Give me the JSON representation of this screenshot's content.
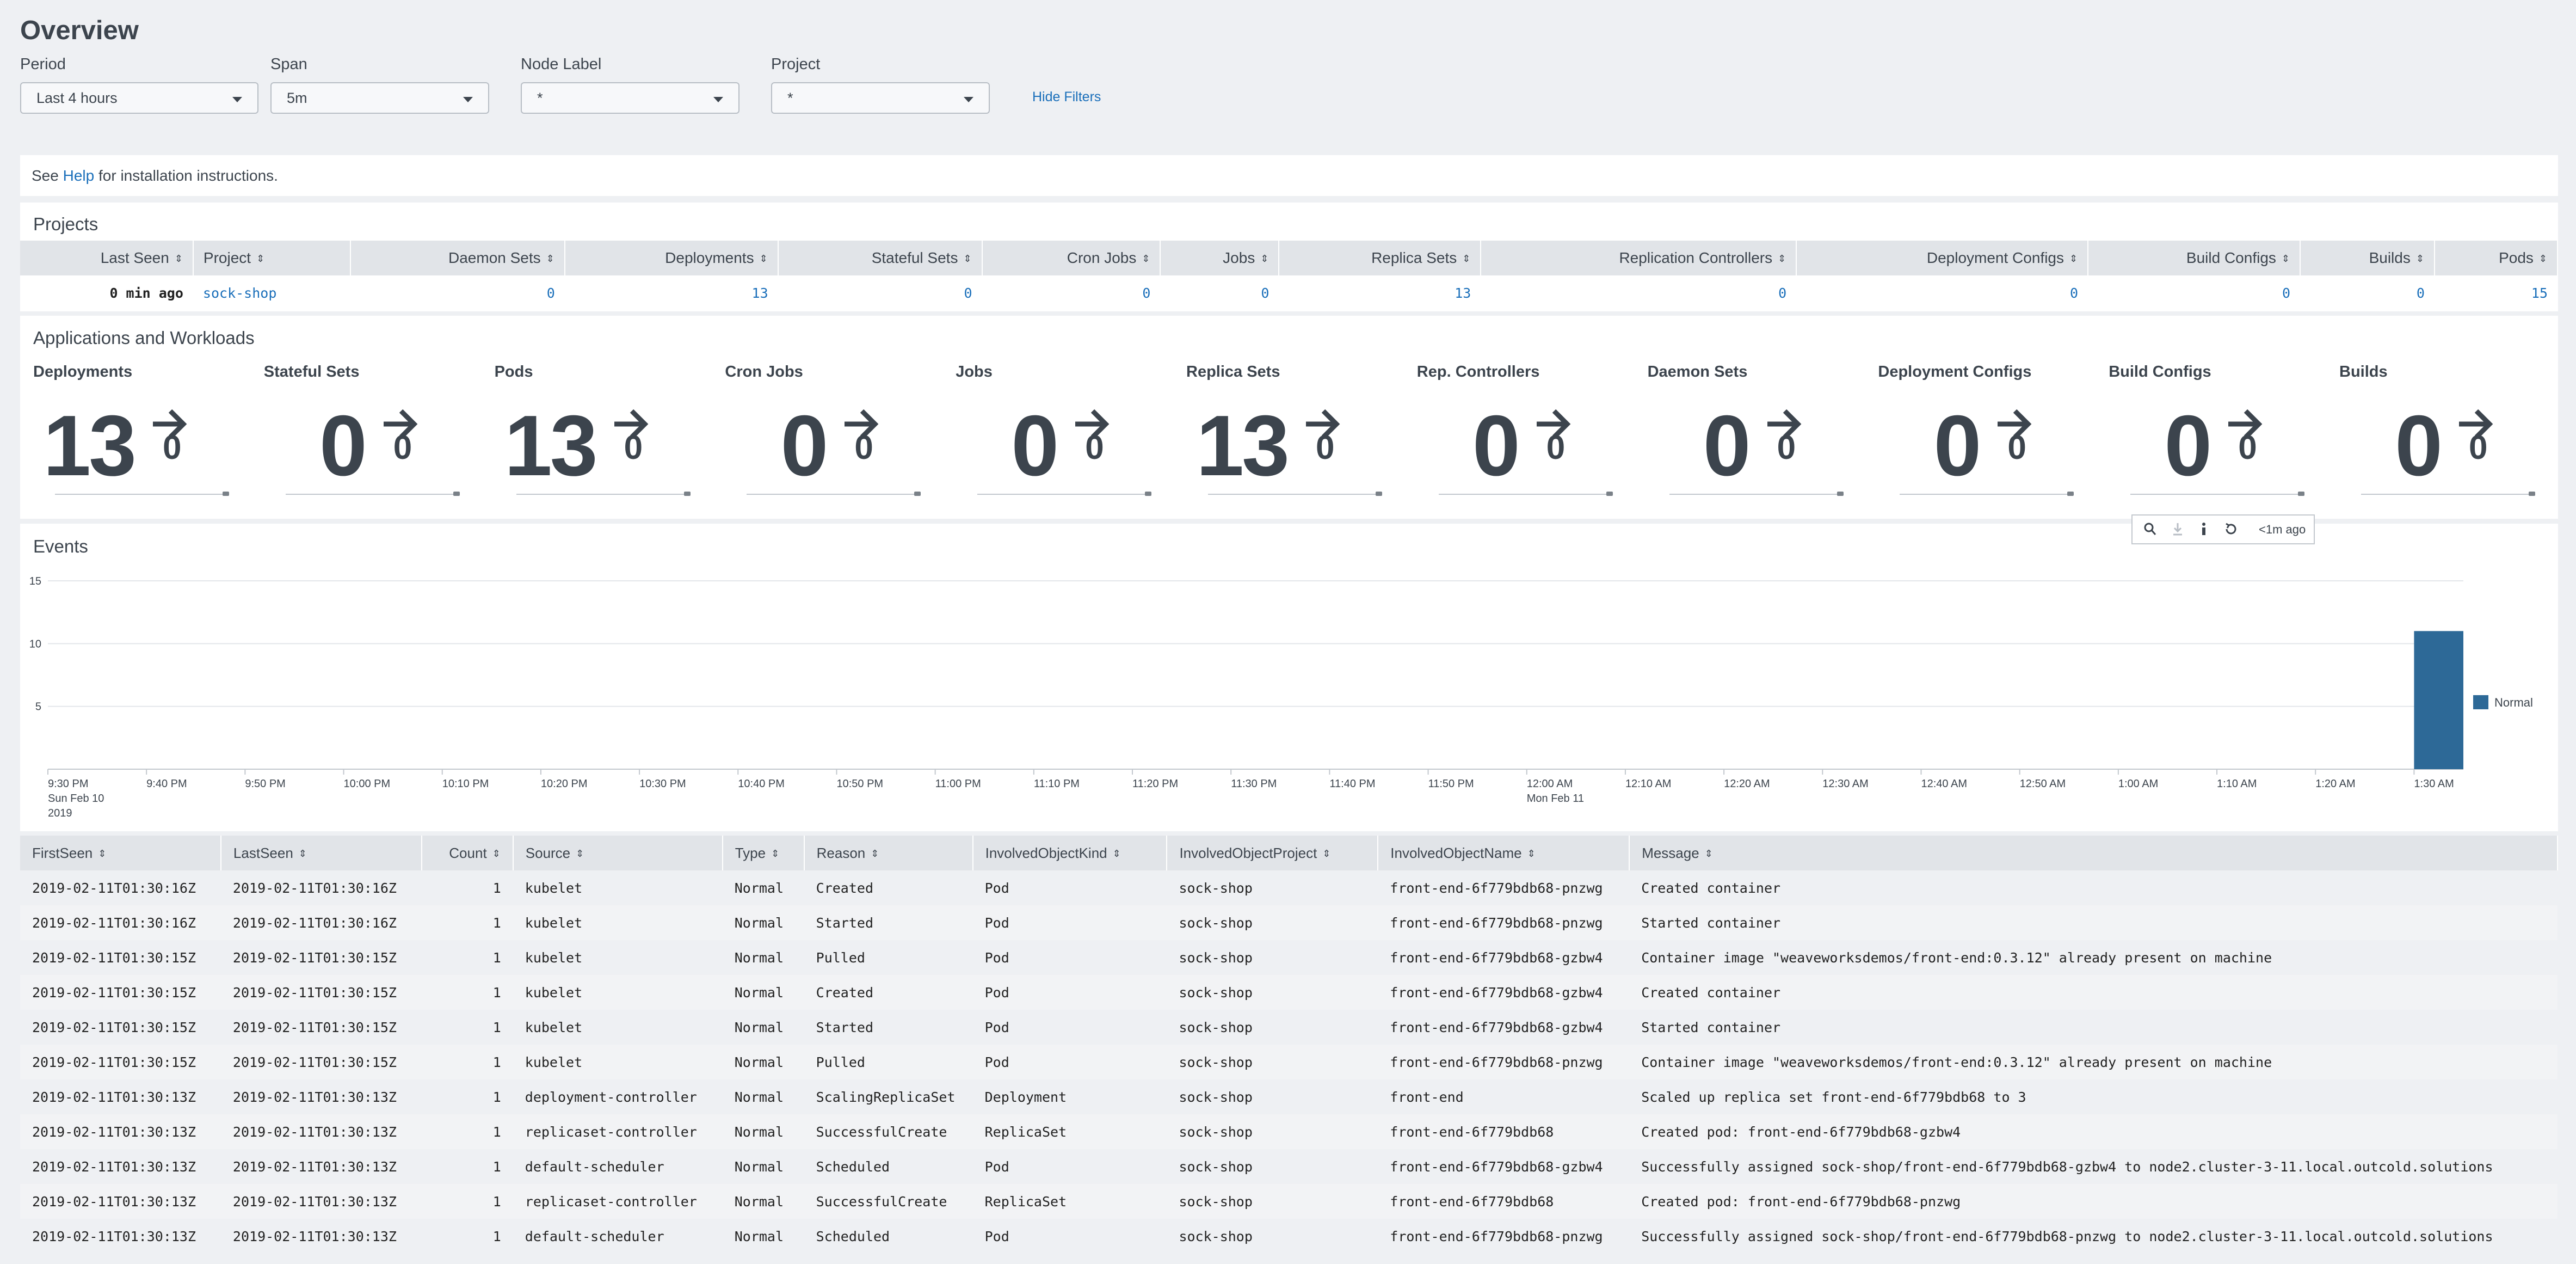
{
  "title": "Overview",
  "filters": {
    "period": {
      "label": "Period",
      "value": "Last 4 hours"
    },
    "span": {
      "label": "Span",
      "value": "5m"
    },
    "node_label": {
      "label": "Node Label",
      "value": "*"
    },
    "project": {
      "label": "Project",
      "value": "*"
    },
    "hide_filters": "Hide Filters"
  },
  "help": {
    "prefix": "See",
    "link": "Help",
    "suffix": "for installation instructions."
  },
  "projects": {
    "title": "Projects",
    "headers": [
      "Last Seen",
      "Project",
      "Daemon Sets",
      "Deployments",
      "Stateful Sets",
      "Cron Jobs",
      "Jobs",
      "Replica Sets",
      "Replication Controllers",
      "Deployment Configs",
      "Build Configs",
      "Builds",
      "Pods"
    ],
    "row": [
      "0 min ago",
      "sock-shop",
      "0",
      "13",
      "0",
      "0",
      "0",
      "13",
      "0",
      "0",
      "0",
      "0",
      "15"
    ]
  },
  "workloads": {
    "title": "Applications and Workloads",
    "items": [
      {
        "label": "Deployments",
        "value": "13",
        "delta": "0"
      },
      {
        "label": "Stateful Sets",
        "value": "0",
        "delta": "0"
      },
      {
        "label": "Pods",
        "value": "13",
        "delta": "0"
      },
      {
        "label": "Cron Jobs",
        "value": "0",
        "delta": "0"
      },
      {
        "label": "Jobs",
        "value": "0",
        "delta": "0"
      },
      {
        "label": "Replica Sets",
        "value": "13",
        "delta": "0"
      },
      {
        "label": "Rep. Controllers",
        "value": "0",
        "delta": "0"
      },
      {
        "label": "Daemon Sets",
        "value": "0",
        "delta": "0"
      },
      {
        "label": "Deployment Configs",
        "value": "0",
        "delta": "0"
      },
      {
        "label": "Build Configs",
        "value": "0",
        "delta": "0"
      },
      {
        "label": "Builds",
        "value": "0",
        "delta": "0"
      }
    ]
  },
  "toolbar": {
    "search_icon": "search-icon",
    "download_icon": "download-icon",
    "info_icon": "info-icon",
    "refresh_icon": "refresh-icon",
    "age": "<1m ago"
  },
  "events": {
    "title": "Events",
    "chart_data": {
      "type": "bar",
      "x_ticks": [
        [
          "9:30 PM",
          "Sun Feb 10",
          "2019"
        ],
        [
          "9:40 PM"
        ],
        [
          "9:50 PM"
        ],
        [
          "10:00 PM"
        ],
        [
          "10:10 PM"
        ],
        [
          "10:20 PM"
        ],
        [
          "10:30 PM"
        ],
        [
          "10:40 PM"
        ],
        [
          "10:50 PM"
        ],
        [
          "11:00 PM"
        ],
        [
          "11:10 PM"
        ],
        [
          "11:20 PM"
        ],
        [
          "11:30 PM"
        ],
        [
          "11:40 PM"
        ],
        [
          "11:50 PM"
        ],
        [
          "12:00 AM",
          "Mon Feb 11"
        ],
        [
          "12:10 AM"
        ],
        [
          "12:20 AM"
        ],
        [
          "12:30 AM"
        ],
        [
          "12:40 AM"
        ],
        [
          "12:50 AM"
        ],
        [
          "1:00 AM"
        ],
        [
          "1:10 AM"
        ],
        [
          "1:20 AM"
        ],
        [
          "1:30 AM"
        ]
      ],
      "y_ticks": [
        "15",
        "10",
        "5"
      ],
      "ylim": [
        0,
        15
      ],
      "xlim_minutes": [
        0,
        245
      ],
      "grid": true,
      "legend_position": "right",
      "series": [
        {
          "name": "Normal",
          "color": "#2d6997",
          "points": [
            {
              "x": "1:30 AM",
              "minute": 240,
              "value": 11
            }
          ]
        }
      ]
    }
  },
  "event_table": {
    "headers": [
      "FirstSeen",
      "LastSeen",
      "Count",
      "Source",
      "Type",
      "Reason",
      "InvolvedObjectKind",
      "InvolvedObjectProject",
      "InvolvedObjectName",
      "Message"
    ],
    "rows": [
      [
        "2019-02-11T01:30:16Z",
        "2019-02-11T01:30:16Z",
        "1",
        "kubelet",
        "Normal",
        "Created",
        "Pod",
        "sock-shop",
        "front-end-6f779bdb68-pnzwg",
        "Created container"
      ],
      [
        "2019-02-11T01:30:16Z",
        "2019-02-11T01:30:16Z",
        "1",
        "kubelet",
        "Normal",
        "Started",
        "Pod",
        "sock-shop",
        "front-end-6f779bdb68-pnzwg",
        "Started container"
      ],
      [
        "2019-02-11T01:30:15Z",
        "2019-02-11T01:30:15Z",
        "1",
        "kubelet",
        "Normal",
        "Pulled",
        "Pod",
        "sock-shop",
        "front-end-6f779bdb68-gzbw4",
        "Container image \"weaveworksdemos/front-end:0.3.12\" already present on machine"
      ],
      [
        "2019-02-11T01:30:15Z",
        "2019-02-11T01:30:15Z",
        "1",
        "kubelet",
        "Normal",
        "Created",
        "Pod",
        "sock-shop",
        "front-end-6f779bdb68-gzbw4",
        "Created container"
      ],
      [
        "2019-02-11T01:30:15Z",
        "2019-02-11T01:30:15Z",
        "1",
        "kubelet",
        "Normal",
        "Started",
        "Pod",
        "sock-shop",
        "front-end-6f779bdb68-gzbw4",
        "Started container"
      ],
      [
        "2019-02-11T01:30:15Z",
        "2019-02-11T01:30:15Z",
        "1",
        "kubelet",
        "Normal",
        "Pulled",
        "Pod",
        "sock-shop",
        "front-end-6f779bdb68-pnzwg",
        "Container image \"weaveworksdemos/front-end:0.3.12\" already present on machine"
      ],
      [
        "2019-02-11T01:30:13Z",
        "2019-02-11T01:30:13Z",
        "1",
        "deployment-controller",
        "Normal",
        "ScalingReplicaSet",
        "Deployment",
        "sock-shop",
        "front-end",
        "Scaled up replica set front-end-6f779bdb68 to 3"
      ],
      [
        "2019-02-11T01:30:13Z",
        "2019-02-11T01:30:13Z",
        "1",
        "replicaset-controller",
        "Normal",
        "SuccessfulCreate",
        "ReplicaSet",
        "sock-shop",
        "front-end-6f779bdb68",
        "Created pod: front-end-6f779bdb68-gzbw4"
      ],
      [
        "2019-02-11T01:30:13Z",
        "2019-02-11T01:30:13Z",
        "1",
        "default-scheduler",
        "Normal",
        "Scheduled",
        "Pod",
        "sock-shop",
        "front-end-6f779bdb68-gzbw4",
        "Successfully assigned sock-shop/front-end-6f779bdb68-gzbw4 to node2.cluster-3-11.local.outcold.solutions"
      ],
      [
        "2019-02-11T01:30:13Z",
        "2019-02-11T01:30:13Z",
        "1",
        "replicaset-controller",
        "Normal",
        "SuccessfulCreate",
        "ReplicaSet",
        "sock-shop",
        "front-end-6f779bdb68",
        "Created pod: front-end-6f779bdb68-pnzwg"
      ],
      [
        "2019-02-11T01:30:13Z",
        "2019-02-11T01:30:13Z",
        "1",
        "default-scheduler",
        "Normal",
        "Scheduled",
        "Pod",
        "sock-shop",
        "front-end-6f779bdb68-pnzwg",
        "Successfully assigned sock-shop/front-end-6f779bdb68-pnzwg to node2.cluster-3-11.local.outcold.solutions"
      ]
    ]
  }
}
